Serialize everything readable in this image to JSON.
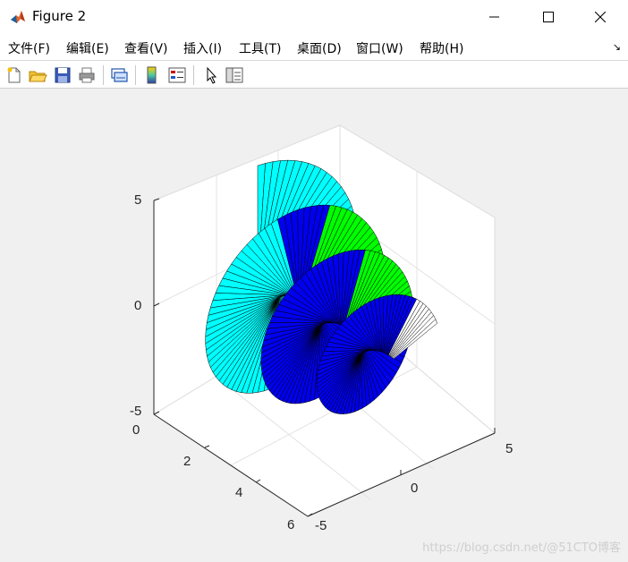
{
  "window": {
    "title": "Figure 2"
  },
  "menu": {
    "items": [
      "文件(F)",
      "编辑(E)",
      "查看(V)",
      "插入(I)",
      "工具(T)",
      "桌面(D)",
      "窗口(W)",
      "帮助(H)"
    ],
    "dock_glyph": "↘"
  },
  "toolbar": {
    "buttons": [
      "new-figure-icon",
      "open-file-icon",
      "save-icon",
      "print-icon",
      "link-plot-icon",
      "colorbar-icon",
      "legend-icon",
      "pointer-icon",
      "property-editor-icon"
    ]
  },
  "plot": {
    "z_ticks": [
      "5",
      "0",
      "-5"
    ],
    "y_ticks": [
      "0",
      "2",
      "4",
      "6"
    ],
    "x_ticks": [
      "-5",
      "0",
      "5"
    ],
    "colors": {
      "cyan": "#00ffff",
      "green": "#00ff00",
      "blue": "#0000ee",
      "lightblue": "#8080ff",
      "white": "#ffffff",
      "background": "#f0f0f0",
      "axes_bg": "#ffffff"
    }
  },
  "watermark": "https://blog.csdn.net/@51CTO博客"
}
